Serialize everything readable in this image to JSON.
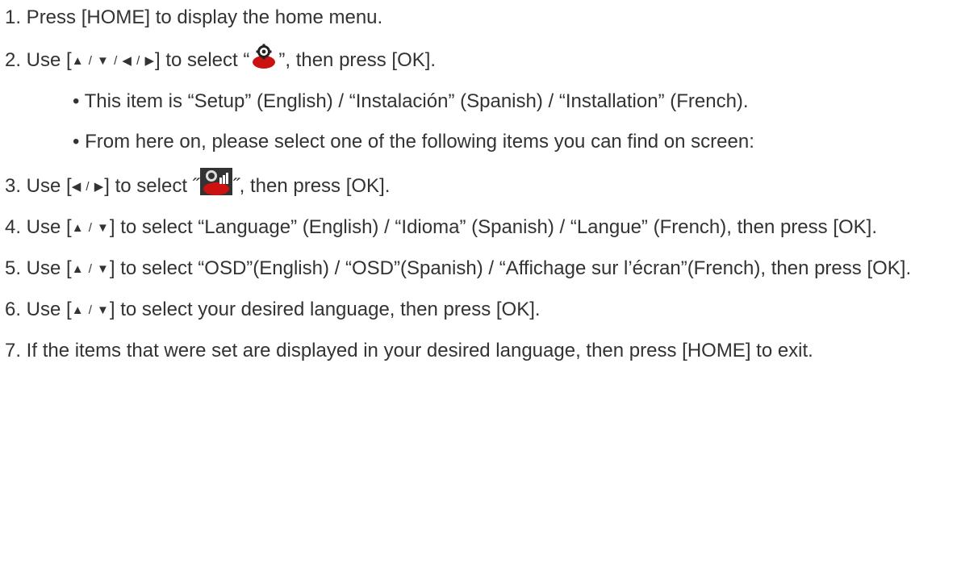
{
  "steps": {
    "s1": {
      "text": "1. Press [HOME] to display the home menu."
    },
    "s2": {
      "pre": "2. Use [",
      "arrows": "▲ / ▼ / ◀ / ▶",
      "mid": "] to select “",
      "icon": "setup-gear-icon",
      "post": "”, then press [OK]."
    },
    "b1": {
      "text": "• This item is “Setup” (English) / “Instalación” (Spanish) / “Installation” (French)."
    },
    "b2": {
      "text": "• From here on, please select one of the following items you can find on screen:"
    },
    "s3": {
      "pre": "3. Use [",
      "arrows": "◀ / ▶",
      "mid": "] to select ˝",
      "icon": "preferences-gear-icon",
      "post": "˝, then press [OK]."
    },
    "s4": {
      "pre": "4. Use [",
      "arrows": "▲ / ▼",
      "post": "] to select “Language” (English) / “Idioma” (Spanish) / “Langue” (French), then press [OK]."
    },
    "s5": {
      "pre": "5. Use [",
      "arrows": "▲ / ▼",
      "post": "] to select “OSD”(English) / “OSD”(Spanish) / “Affichage sur l’écran”(French), then press [OK]."
    },
    "s6": {
      "pre": "6. Use [",
      "arrows": "▲ / ▼",
      "post": "] to select your desired language, then press [OK]."
    },
    "s7": {
      "text": "7. If the items that were set are displayed in your desired language, then press [HOME] to exit."
    }
  },
  "colors": {
    "text": "#333333",
    "icon_red": "#cc1111",
    "icon_dark": "#222222"
  }
}
